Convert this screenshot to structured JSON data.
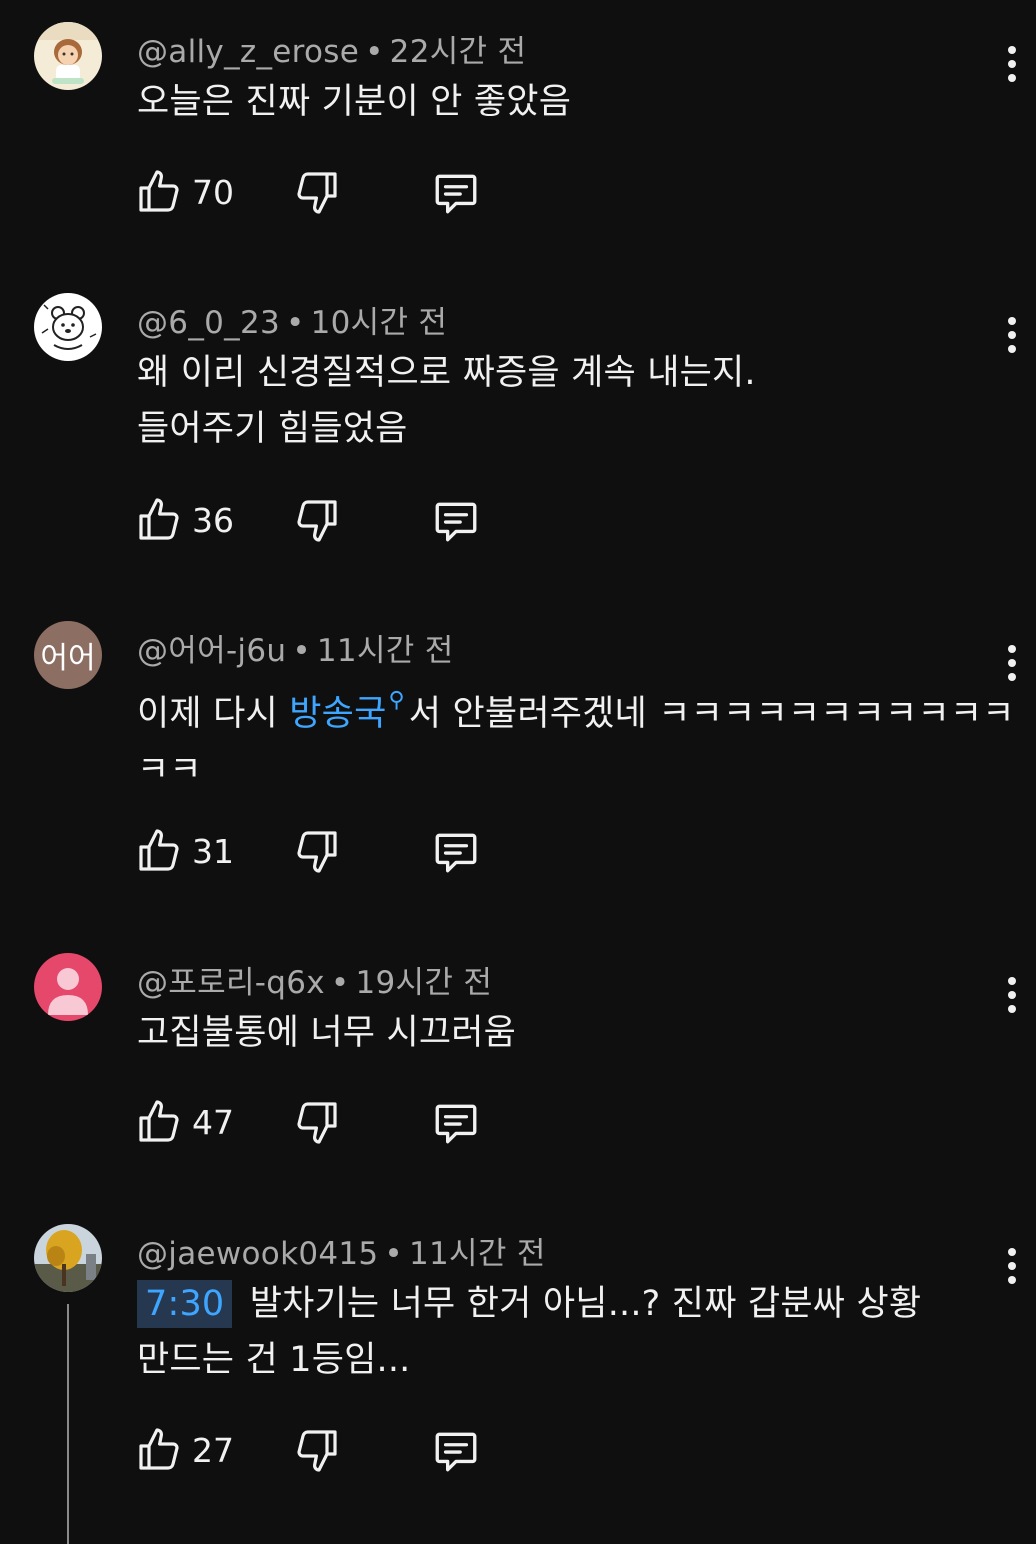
{
  "comments": [
    {
      "handle": "@ally_z_erose",
      "sep": "•",
      "time": "22시간 전",
      "text_lines": [
        "오늘은 진짜 기분이 안 좋았음"
      ],
      "likes": "70",
      "avatar": "cartoon-girl-avatar"
    },
    {
      "handle": "@6_0_23",
      "sep": "•",
      "time": "10시간 전",
      "text_lines": [
        "왜 이리 신경질적으로 짜증을 계속 내는지.",
        "들어주기 힘들었음"
      ],
      "likes": "36",
      "avatar": "bear-doodle-avatar"
    },
    {
      "handle": "@어어-j6u",
      "sep": "•",
      "time": "11시간 전",
      "text_pre": "이제 다시 ",
      "text_link": "방송국",
      "search_mark": "⚲",
      "text_post": "서 안불러주겠네 ㅋㅋㅋㅋㅋㅋㅋㅋㅋㅋㅋ",
      "text_line2": "ㅋㅋ",
      "likes": "31",
      "avatar_initials": "어어",
      "avatar_color": "#8d6e63"
    },
    {
      "handle": "@포로리-q6x",
      "sep": "•",
      "time": "19시간 전",
      "text_lines": [
        "고집불통에 너무 시끄러움"
      ],
      "likes": "47",
      "avatar": "default-person-avatar",
      "avatar_color": "#e5486b"
    },
    {
      "handle": "@jaewook0415",
      "sep": "•",
      "time": "11시간 전",
      "timestamp_link": "7:30",
      "text_after_ts": " 발차기는 너무 한거 아님...? 진짜 갑분싸 상황",
      "text_line2": "만드는 건 1등임...",
      "likes": "27",
      "avatar": "autumn-tree-avatar"
    }
  ],
  "colors": {
    "background": "#0f0f0f",
    "text": "#f1f1f1",
    "meta": "#aaaaaa",
    "link": "#3ea6ff"
  }
}
